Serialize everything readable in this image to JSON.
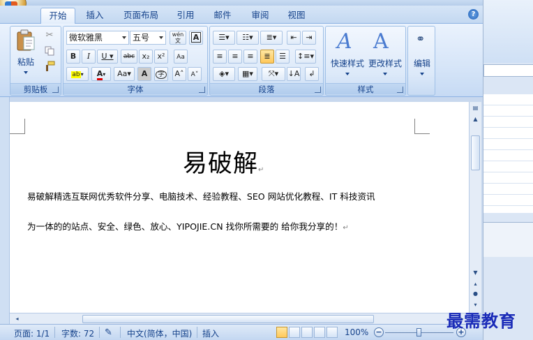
{
  "tabs": [
    {
      "label": "开始",
      "active": true
    },
    {
      "label": "插入"
    },
    {
      "label": "页面布局"
    },
    {
      "label": "引用"
    },
    {
      "label": "邮件"
    },
    {
      "label": "审阅"
    },
    {
      "label": "视图"
    }
  ],
  "groups": {
    "clipboard": {
      "label": "剪贴板",
      "paste_label": "粘贴"
    },
    "font": {
      "label": "字体",
      "font_name": "微软雅黑",
      "font_size": "五号"
    },
    "paragraph": {
      "label": "段落"
    },
    "styles": {
      "label": "样式",
      "quick_styles_label": "快速样式",
      "change_styles_label": "更改样式"
    },
    "editing": {
      "label": "编辑"
    }
  },
  "document": {
    "title": "易破解",
    "line1": "易破解精选互联网优秀软件分享、电脑技术、经验教程、SEO 网站优化教程、IT 科技资讯",
    "line2": "为一体的的站点、安全、绿色、放心、YIPOJIE.CN  找你所需要的  给你我分享的！"
  },
  "statusbar": {
    "page": "页面: 1/1",
    "words": "字数: 72",
    "language": "中文(简体，中国)",
    "mode": "插入",
    "zoom": "100%",
    "zoom_out": "−",
    "zoom_in": "+"
  },
  "watermark": "最需教育",
  "colors": {
    "accent": "#15428b",
    "ribbon": "#dce9f9",
    "highlight": "#ffc85a"
  }
}
